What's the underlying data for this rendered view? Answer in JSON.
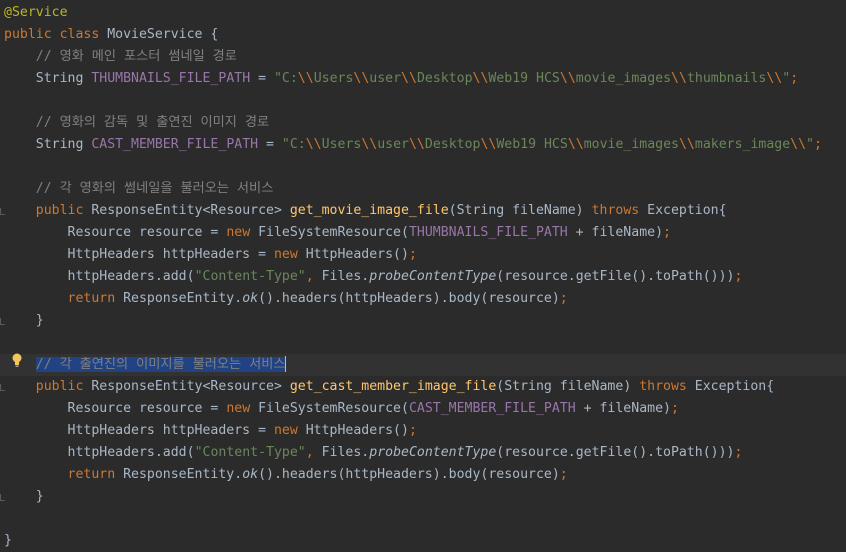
{
  "editor": {
    "lines": [
      [
        {
          "t": "@Service",
          "c": "ann"
        }
      ],
      [
        {
          "t": "public class ",
          "c": "kw"
        },
        {
          "t": "MovieService {",
          "c": "plain"
        }
      ],
      [
        {
          "t": "    // 영화 메인 포스터 썸네일 경로",
          "c": "cmt"
        }
      ],
      [
        {
          "t": "    String ",
          "c": "plain"
        },
        {
          "t": "THUMBNAILS_FILE_PATH",
          "c": "const"
        },
        {
          "t": " = ",
          "c": "plain"
        },
        {
          "t": "\"C:",
          "c": "str"
        },
        {
          "t": "\\\\",
          "c": "esc"
        },
        {
          "t": "Users",
          "c": "str"
        },
        {
          "t": "\\\\",
          "c": "esc"
        },
        {
          "t": "user",
          "c": "str"
        },
        {
          "t": "\\\\",
          "c": "esc"
        },
        {
          "t": "Desktop",
          "c": "str"
        },
        {
          "t": "\\\\",
          "c": "esc"
        },
        {
          "t": "Web19 HCS",
          "c": "str"
        },
        {
          "t": "\\\\",
          "c": "esc"
        },
        {
          "t": "movie_images",
          "c": "str"
        },
        {
          "t": "\\\\",
          "c": "esc"
        },
        {
          "t": "thumbnails",
          "c": "str"
        },
        {
          "t": "\\\\",
          "c": "esc"
        },
        {
          "t": "\"",
          "c": "str"
        },
        {
          "t": ";",
          "c": "kw"
        }
      ],
      [],
      [
        {
          "t": "    // 영화의 감독 및 출연진 이미지 경로",
          "c": "cmt"
        }
      ],
      [
        {
          "t": "    String ",
          "c": "plain"
        },
        {
          "t": "CAST_MEMBER_FILE_PATH",
          "c": "const"
        },
        {
          "t": " = ",
          "c": "plain"
        },
        {
          "t": "\"C:",
          "c": "str"
        },
        {
          "t": "\\\\",
          "c": "esc"
        },
        {
          "t": "Users",
          "c": "str"
        },
        {
          "t": "\\\\",
          "c": "esc"
        },
        {
          "t": "user",
          "c": "str"
        },
        {
          "t": "\\\\",
          "c": "esc"
        },
        {
          "t": "Desktop",
          "c": "str"
        },
        {
          "t": "\\\\",
          "c": "esc"
        },
        {
          "t": "Web19 HCS",
          "c": "str"
        },
        {
          "t": "\\\\",
          "c": "esc"
        },
        {
          "t": "movie_images",
          "c": "str"
        },
        {
          "t": "\\\\",
          "c": "esc"
        },
        {
          "t": "makers_image",
          "c": "str"
        },
        {
          "t": "\\\\",
          "c": "esc"
        },
        {
          "t": "\"",
          "c": "str"
        },
        {
          "t": ";",
          "c": "kw"
        }
      ],
      [],
      [
        {
          "t": "    // 각 영화의 썸네일을 불러오는 서비스",
          "c": "cmt"
        }
      ],
      [
        {
          "t": "    public ",
          "c": "kw"
        },
        {
          "t": "ResponseEntity<Resource> ",
          "c": "plain"
        },
        {
          "t": "get_movie_image_file",
          "c": "fn"
        },
        {
          "t": "(String fileName) ",
          "c": "plain"
        },
        {
          "t": "throws ",
          "c": "kw"
        },
        {
          "t": "Exception{",
          "c": "plain"
        }
      ],
      [
        {
          "t": "        Resource resource = ",
          "c": "plain"
        },
        {
          "t": "new ",
          "c": "kw"
        },
        {
          "t": "FileSystemResource(",
          "c": "plain"
        },
        {
          "t": "THUMBNAILS_FILE_PATH",
          "c": "const"
        },
        {
          "t": " + fileName)",
          "c": "plain"
        },
        {
          "t": ";",
          "c": "kw"
        }
      ],
      [
        {
          "t": "        HttpHeaders httpHeaders = ",
          "c": "plain"
        },
        {
          "t": "new ",
          "c": "kw"
        },
        {
          "t": "HttpHeaders()",
          "c": "plain"
        },
        {
          "t": ";",
          "c": "kw"
        }
      ],
      [
        {
          "t": "        httpHeaders.add(",
          "c": "plain"
        },
        {
          "t": "\"Content-Type\"",
          "c": "str"
        },
        {
          "t": ", ",
          "c": "kw"
        },
        {
          "t": "Files.",
          "c": "plain"
        },
        {
          "t": "probeContentType",
          "c": "static"
        },
        {
          "t": "(resource.getFile().toPath()))",
          "c": "plain"
        },
        {
          "t": ";",
          "c": "kw"
        }
      ],
      [
        {
          "t": "        return ",
          "c": "kw"
        },
        {
          "t": "ResponseEntity.",
          "c": "plain"
        },
        {
          "t": "ok",
          "c": "static"
        },
        {
          "t": "().headers(httpHeaders).body(resource)",
          "c": "plain"
        },
        {
          "t": ";",
          "c": "kw"
        }
      ],
      [
        {
          "t": "    }",
          "c": "plain"
        }
      ],
      [],
      [
        {
          "t": "    ",
          "c": "plain"
        },
        {
          "t": "// 각 출연진의 이미지를 불러오는 서비스",
          "c": "cmt",
          "sel": true
        }
      ],
      [
        {
          "t": "    public ",
          "c": "kw"
        },
        {
          "t": "ResponseEntity<Resource> ",
          "c": "plain"
        },
        {
          "t": "get_cast_member_image_file",
          "c": "fn"
        },
        {
          "t": "(String fileName) ",
          "c": "plain"
        },
        {
          "t": "throws ",
          "c": "kw"
        },
        {
          "t": "Exception{",
          "c": "plain"
        }
      ],
      [
        {
          "t": "        Resource resource = ",
          "c": "plain"
        },
        {
          "t": "new ",
          "c": "kw"
        },
        {
          "t": "FileSystemResource(",
          "c": "plain"
        },
        {
          "t": "CAST_MEMBER_FILE_PATH",
          "c": "const"
        },
        {
          "t": " + fileName)",
          "c": "plain"
        },
        {
          "t": ";",
          "c": "kw"
        }
      ],
      [
        {
          "t": "        HttpHeaders httpHeaders = ",
          "c": "plain"
        },
        {
          "t": "new ",
          "c": "kw"
        },
        {
          "t": "HttpHeaders()",
          "c": "plain"
        },
        {
          "t": ";",
          "c": "kw"
        }
      ],
      [
        {
          "t": "        httpHeaders.add(",
          "c": "plain"
        },
        {
          "t": "\"Content-Type\"",
          "c": "str"
        },
        {
          "t": ", ",
          "c": "kw"
        },
        {
          "t": "Files.",
          "c": "plain"
        },
        {
          "t": "probeContentType",
          "c": "static"
        },
        {
          "t": "(resource.getFile().toPath()))",
          "c": "plain"
        },
        {
          "t": ";",
          "c": "kw"
        }
      ],
      [
        {
          "t": "        return ",
          "c": "kw"
        },
        {
          "t": "ResponseEntity.",
          "c": "plain"
        },
        {
          "t": "ok",
          "c": "static"
        },
        {
          "t": "().headers(httpHeaders).body(resource)",
          "c": "plain"
        },
        {
          "t": ";",
          "c": "kw"
        }
      ],
      [
        {
          "t": "    }",
          "c": "plain"
        }
      ],
      [],
      [
        {
          "t": "}",
          "c": "plain"
        }
      ]
    ],
    "current_line": 16,
    "bulb_line": 16,
    "fold_marks": [
      9,
      14,
      17,
      22
    ],
    "colors": {
      "background": "#2b2b2b",
      "keyword": "#cc7832",
      "annotation": "#bbb529",
      "string": "#6a8759",
      "comment": "#808080",
      "constant": "#9876aa",
      "method": "#ffc66d",
      "text": "#a9b7c6",
      "selection": "#214283"
    },
    "icons": {
      "bulb": "lightbulb-icon"
    }
  }
}
